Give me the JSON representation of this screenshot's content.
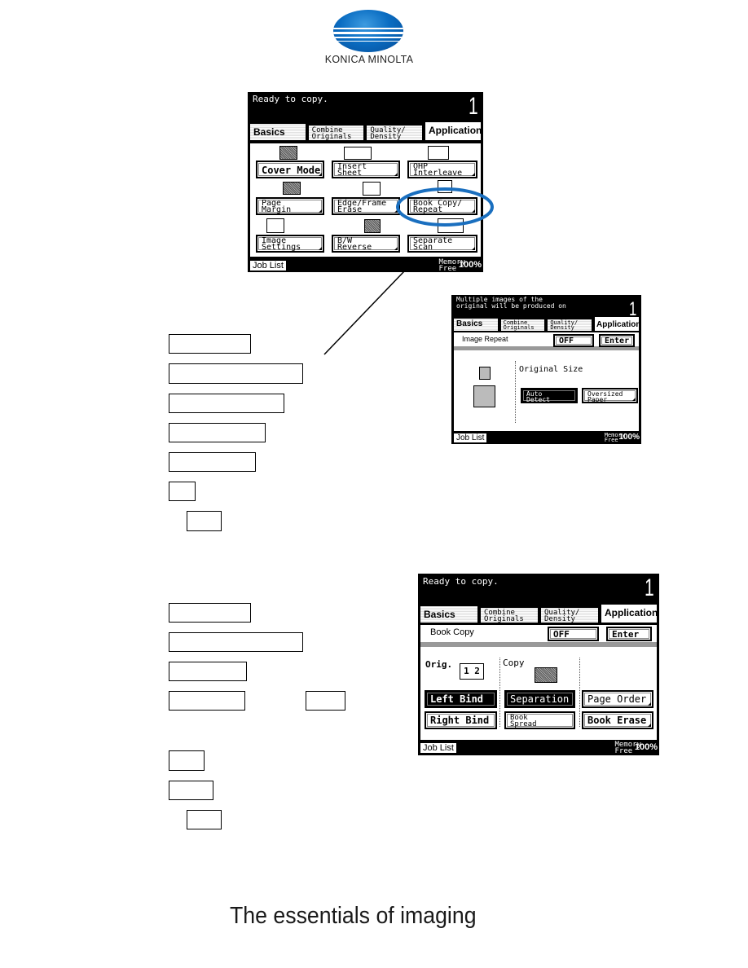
{
  "logo": {
    "brand": "KONICA MINOLTA",
    "colors": {
      "globe": "#0a6dc2"
    }
  },
  "panel1": {
    "message": "Ready to copy.",
    "count": "1",
    "tabs": [
      {
        "label": "Basics"
      },
      {
        "label": "Combine\nOriginals"
      },
      {
        "label": "Quality/\nDensity"
      },
      {
        "label": "Application"
      }
    ],
    "buttons": [
      {
        "label": "Cover Mode"
      },
      {
        "label": "Insert\nSheet"
      },
      {
        "label": "OHP\nInterleave"
      },
      {
        "label": "Page\nMargin"
      },
      {
        "label": "Edge/Frame\nErase"
      },
      {
        "label": "Book Copy/\nRepeat"
      },
      {
        "label": "Image\nSettings"
      },
      {
        "label": "B/W\nReverse"
      },
      {
        "label": "Separate\nScan"
      }
    ],
    "job_list": "Job List",
    "memory_label": "Memory\nFree",
    "memory_value": "100%",
    "highlight_color": "#1a6fbf"
  },
  "panel2": {
    "message": "Multiple images of the\noriginal will be produced on",
    "count": "1",
    "tabs": [
      {
        "label": "Basics"
      },
      {
        "label": "Combine\nOriginals"
      },
      {
        "label": "Quality/\nDensity"
      },
      {
        "label": "Application"
      }
    ],
    "function_title": "Image Repeat",
    "off_label": "OFF",
    "enter_label": "Enter",
    "original_size_label": "Original Size",
    "buttons": [
      {
        "label": "Auto\nDetect",
        "selected": true
      },
      {
        "label": "Oversized\nPaper",
        "selected": false
      }
    ],
    "job_list": "Job List",
    "memory_label": "Memory\nFree",
    "memory_value": "100%"
  },
  "panel3": {
    "message": "Ready to copy.",
    "count": "1",
    "tabs": [
      {
        "label": "Basics"
      },
      {
        "label": "Combine\nOriginals"
      },
      {
        "label": "Quality/\nDensity"
      },
      {
        "label": "Application"
      }
    ],
    "function_title": "Book Copy",
    "off_label": "OFF",
    "enter_label": "Enter",
    "orig_label": "Orig.",
    "copy_label": "Copy",
    "orig_icon_text": "1 2",
    "buttons": [
      {
        "label": "Left Bind",
        "selected": true
      },
      {
        "label": "Separation",
        "selected": true
      },
      {
        "label": "Page Order",
        "selected": false
      },
      {
        "label": "Right Bind",
        "selected": false
      },
      {
        "label": "Book\nSpread",
        "selected": false
      },
      {
        "label": "Book Erase",
        "selected": false
      }
    ],
    "job_list": "Job List",
    "memory_label": "Memory\nFree",
    "memory_value": "100%"
  },
  "tagline": "The essentials of imaging"
}
